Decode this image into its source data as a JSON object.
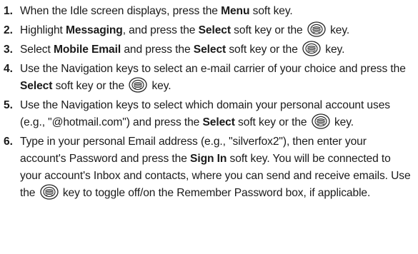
{
  "steps": [
    {
      "num": "1.",
      "parts": [
        {
          "t": "When the Idle screen displays, press the "
        },
        {
          "t": "Menu",
          "b": true
        },
        {
          "t": " soft key."
        }
      ]
    },
    {
      "num": "2.",
      "parts": [
        {
          "t": "Highlight "
        },
        {
          "t": "Messaging",
          "b": true
        },
        {
          "t": ", and press the "
        },
        {
          "t": "Select",
          "b": true
        },
        {
          "t": " soft key or the "
        },
        {
          "icon": "ok-key-icon"
        },
        {
          "t": " key."
        }
      ]
    },
    {
      "num": "3.",
      "parts": [
        {
          "t": "Select "
        },
        {
          "t": "Mobile Email",
          "b": true
        },
        {
          "t": " and press the "
        },
        {
          "t": "Select",
          "b": true
        },
        {
          "t": " soft key or the "
        },
        {
          "icon": "ok-key-icon"
        },
        {
          "t": " key."
        }
      ]
    },
    {
      "num": "4.",
      "parts": [
        {
          "t": "Use the Navigation keys to select an e-mail carrier of your choice and press the "
        },
        {
          "t": "Select",
          "b": true
        },
        {
          "t": " soft key or the "
        },
        {
          "icon": "ok-key-icon"
        },
        {
          "t": " key."
        }
      ]
    },
    {
      "num": "5.",
      "parts": [
        {
          "t": "Use the Navigation keys to select which domain your personal account uses (e.g., \"@hotmail.com\") and press the "
        },
        {
          "t": "Select",
          "b": true
        },
        {
          "t": " soft key or the "
        },
        {
          "icon": "ok-key-icon"
        },
        {
          "t": " key."
        }
      ]
    },
    {
      "num": "6.",
      "parts": [
        {
          "t": "Type in your personal Email address (e.g., \"silverfox2\"), then enter your account's Password and press the "
        },
        {
          "t": "Sign In",
          "b": true
        },
        {
          "t": " soft key. You will be connected to your account's Inbox and contacts, where you can send and receive emails. Use the "
        },
        {
          "icon": "ok-key-icon"
        },
        {
          "t": " key to toggle off/on the Remember Password box, if applicable."
        }
      ]
    }
  ]
}
